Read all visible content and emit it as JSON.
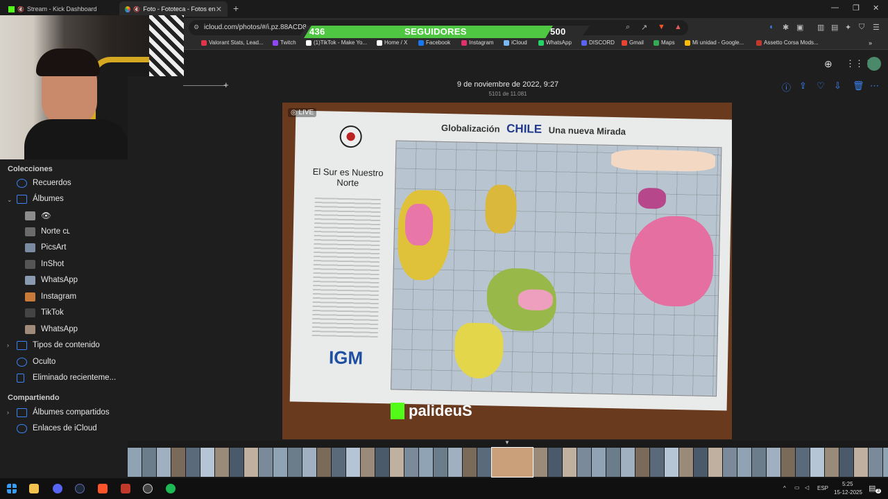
{
  "browser": {
    "tabs": [
      {
        "label": "Stream - Kick Dashboard",
        "active": false
      },
      {
        "label": "Foto - Fototeca - Fotos en iCl...",
        "active": true
      }
    ],
    "url": "icloud.com/photos/#/i.pz.88ACD8...",
    "bookmarks": [
      {
        "label": "Valorant Stats, Lead...",
        "color": "#e0364a"
      },
      {
        "label": "Twitch",
        "color": "#9146ff"
      },
      {
        "label": "(1)TikTok - Make Yo...",
        "color": "#ffffff"
      },
      {
        "label": "Home / X",
        "color": "#ffffff"
      },
      {
        "label": "Facebook",
        "color": "#1877f2"
      },
      {
        "label": "Instagram",
        "color": "#e1306c"
      },
      {
        "label": "iCloud",
        "color": "#7ab8f5"
      },
      {
        "label": "WhatsApp",
        "color": "#25d366"
      },
      {
        "label": "DISCORD",
        "color": "#5865f2"
      },
      {
        "label": "Gmail",
        "color": "#ea4335"
      },
      {
        "label": "Maps",
        "color": "#34a853"
      },
      {
        "label": "Mi unidad - Google...",
        "color": "#fbbc04"
      },
      {
        "label": "Assetto Corsa Mods...",
        "color": "#c0392b"
      }
    ]
  },
  "overlay": {
    "count_current": "436",
    "label": "SEGUIDORES",
    "count_goal": "500",
    "progress": 0.872
  },
  "sidebar": {
    "collections_heading": "Colecciones",
    "items": [
      {
        "label": "Recuerdos",
        "icon": "memories-icon",
        "color": "#3b82f6"
      },
      {
        "label": "Álbumes",
        "icon": "albums-icon",
        "color": "#3b82f6"
      },
      {
        "label": "👁",
        "icon": "album-thumb",
        "color": "#888888"
      },
      {
        "label": "Norte ᴄʟ",
        "icon": "album-thumb",
        "color": "#6b6b6b"
      },
      {
        "label": "PicsArt",
        "icon": "album-thumb",
        "color": "#7a8aa0"
      },
      {
        "label": "InShot",
        "icon": "album-thumb",
        "color": "#555555"
      },
      {
        "label": "WhatsApp",
        "icon": "album-thumb",
        "color": "#8a9ab0"
      },
      {
        "label": "Instagram",
        "icon": "album-thumb",
        "color": "#c77a3a"
      },
      {
        "label": "TikTok",
        "icon": "album-thumb",
        "color": "#444444"
      },
      {
        "label": "WhatsApp",
        "icon": "album-thumb",
        "color": "#a08a7a"
      },
      {
        "label": "Tipos de contenido",
        "icon": "media-types-icon",
        "color": "#3b82f6"
      },
      {
        "label": "Oculto",
        "icon": "hidden-eye-icon",
        "color": "#3b82f6"
      },
      {
        "label": "Eliminado recienteme...",
        "icon": "trash-icon",
        "color": "#3b82f6"
      }
    ],
    "sharing_heading": "Compartiendo",
    "sharing_items": [
      {
        "label": "Álbumes compartidos",
        "icon": "shared-albums-icon",
        "color": "#3b82f6"
      },
      {
        "label": "Enlaces de iCloud",
        "icon": "icloud-links-icon",
        "color": "#3b82f6"
      }
    ]
  },
  "viewer": {
    "title": "9 de noviembre de 2022, 9:27",
    "subtitle": "5101 de 11.081",
    "live_badge": "LIVE",
    "watermark": "palideuS"
  },
  "map_photo": {
    "title_left": "Globalización",
    "title_center": "CHILE",
    "title_right": "Una nueva Mirada",
    "left_heading": "El Sur es Nuestro Norte",
    "logo": "IGM"
  },
  "taskbar": {
    "language": "ESP",
    "time": "5:25",
    "date": "15-12-2025",
    "notifications": "3"
  },
  "colors": {
    "accent": "#3b82f6",
    "overlay_green": "#4fc742",
    "kick_green": "#53fc18"
  }
}
